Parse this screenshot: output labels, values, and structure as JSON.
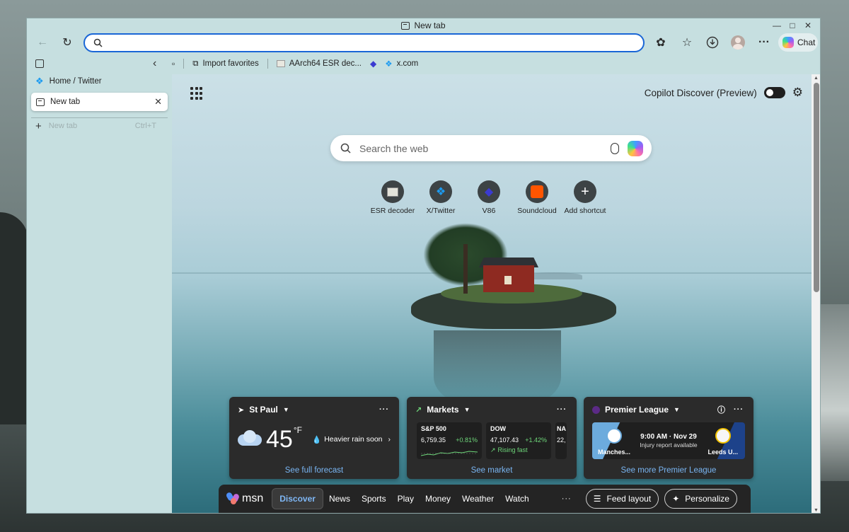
{
  "window": {
    "title": "New tab"
  },
  "toolbar": {
    "address_value": "",
    "chat_label": "Chat"
  },
  "sidebar": {
    "items": [
      {
        "label": "Home / Twitter"
      },
      {
        "label": "New tab"
      }
    ],
    "new_tab_label": "New tab",
    "new_tab_shortcut": "Ctrl+T"
  },
  "favorites": [
    {
      "label": "Import favorites"
    },
    {
      "label": "AArch64 ESR dec..."
    },
    {
      "label": "x.com"
    }
  ],
  "newtab": {
    "discover_label": "Copilot Discover (Preview)",
    "search_placeholder": "Search the web",
    "shortcuts": [
      {
        "label": "ESR decoder"
      },
      {
        "label": "X/Twitter"
      },
      {
        "label": "V86"
      },
      {
        "label": "Soundcloud"
      },
      {
        "label": "Add shortcut"
      }
    ]
  },
  "weather": {
    "location": "St Paul",
    "temp": "45",
    "unit": "°F",
    "forecast": "Heavier rain soon",
    "link": "See full forecast"
  },
  "markets": {
    "title": "Markets",
    "tickers": [
      {
        "name": "S&P 500",
        "value": "6,759.35",
        "change": "+0.81%",
        "note": ""
      },
      {
        "name": "DOW",
        "value": "47,107.43",
        "change": "+1.42%",
        "note": "Rising fast"
      },
      {
        "name": "NA",
        "value": "22,",
        "change": "",
        "note": ""
      }
    ],
    "link": "See market"
  },
  "league": {
    "title": "Premier League",
    "time": "9:00 AM · Nov 29",
    "status": "Injury report available",
    "home": "Manches...",
    "away": "Leeds U...",
    "link": "See more Premier League"
  },
  "msn": {
    "brand": "msn",
    "nav": [
      "Discover",
      "News",
      "Sports",
      "Play",
      "Money",
      "Weather",
      "Watch"
    ],
    "more": "···",
    "feed_layout": "Feed layout",
    "personalize": "Personalize"
  },
  "colors": {
    "accent": "#1a66d6",
    "link": "#79b5f2",
    "card_bg": "#2b2b2b",
    "positive": "#6ed77a"
  }
}
